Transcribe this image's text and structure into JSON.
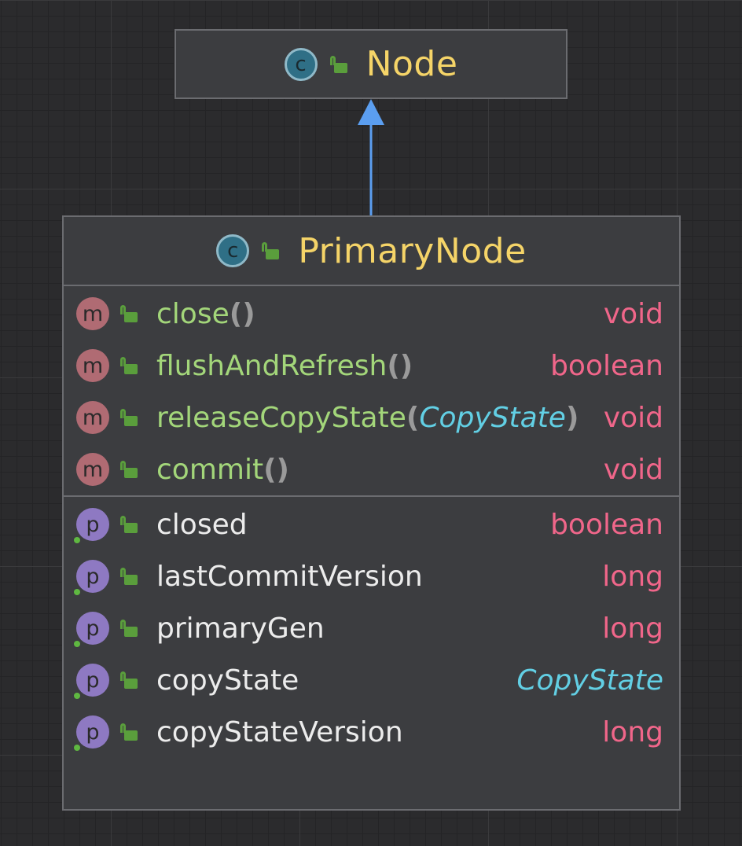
{
  "parent_class": {
    "name": "Node",
    "kind_badge": "c",
    "kind_icon": "class-icon",
    "visibility_icon": "public-lock-icon"
  },
  "relation": {
    "type": "inheritance",
    "color": "#5b9ef0"
  },
  "class": {
    "name": "PrimaryNode",
    "kind_badge": "c",
    "kind_icon": "class-icon",
    "visibility_icon": "public-lock-icon",
    "methods": [
      {
        "badge": "m",
        "name": "close",
        "open": "(",
        "param": "",
        "close": ")",
        "type": "void",
        "type_kind": "primitive"
      },
      {
        "badge": "m",
        "name": "flushAndRefresh",
        "open": "(",
        "param": "",
        "close": ")",
        "type": "boolean",
        "type_kind": "primitive"
      },
      {
        "badge": "m",
        "name": "releaseCopyState",
        "open": "(",
        "param": "CopyState",
        "close": ")",
        "type": "void",
        "type_kind": "primitive"
      },
      {
        "badge": "m",
        "name": "commit",
        "open": "(",
        "param": "",
        "close": ")",
        "type": "void",
        "type_kind": "primitive"
      }
    ],
    "fields": [
      {
        "badge": "p",
        "name": "closed",
        "type": "boolean",
        "type_kind": "primitive"
      },
      {
        "badge": "p",
        "name": "lastCommitVersion",
        "type": "long",
        "type_kind": "primitive"
      },
      {
        "badge": "p",
        "name": "primaryGen",
        "type": "long",
        "type_kind": "primitive"
      },
      {
        "badge": "p",
        "name": "copyState",
        "type": "CopyState",
        "type_kind": "class"
      },
      {
        "badge": "p",
        "name": "copyStateVersion",
        "type": "long",
        "type_kind": "primitive"
      }
    ]
  },
  "colors": {
    "background": "#2b2b2d",
    "class_name": "#f5d468",
    "method_name": "#a3d67a",
    "field_name": "#ececec",
    "primitive_type": "#f0668a",
    "class_type": "#62cfe4",
    "method_badge": "#b06b73",
    "field_badge": "#8e79c2",
    "visibility_public": "#5a9e3c"
  }
}
